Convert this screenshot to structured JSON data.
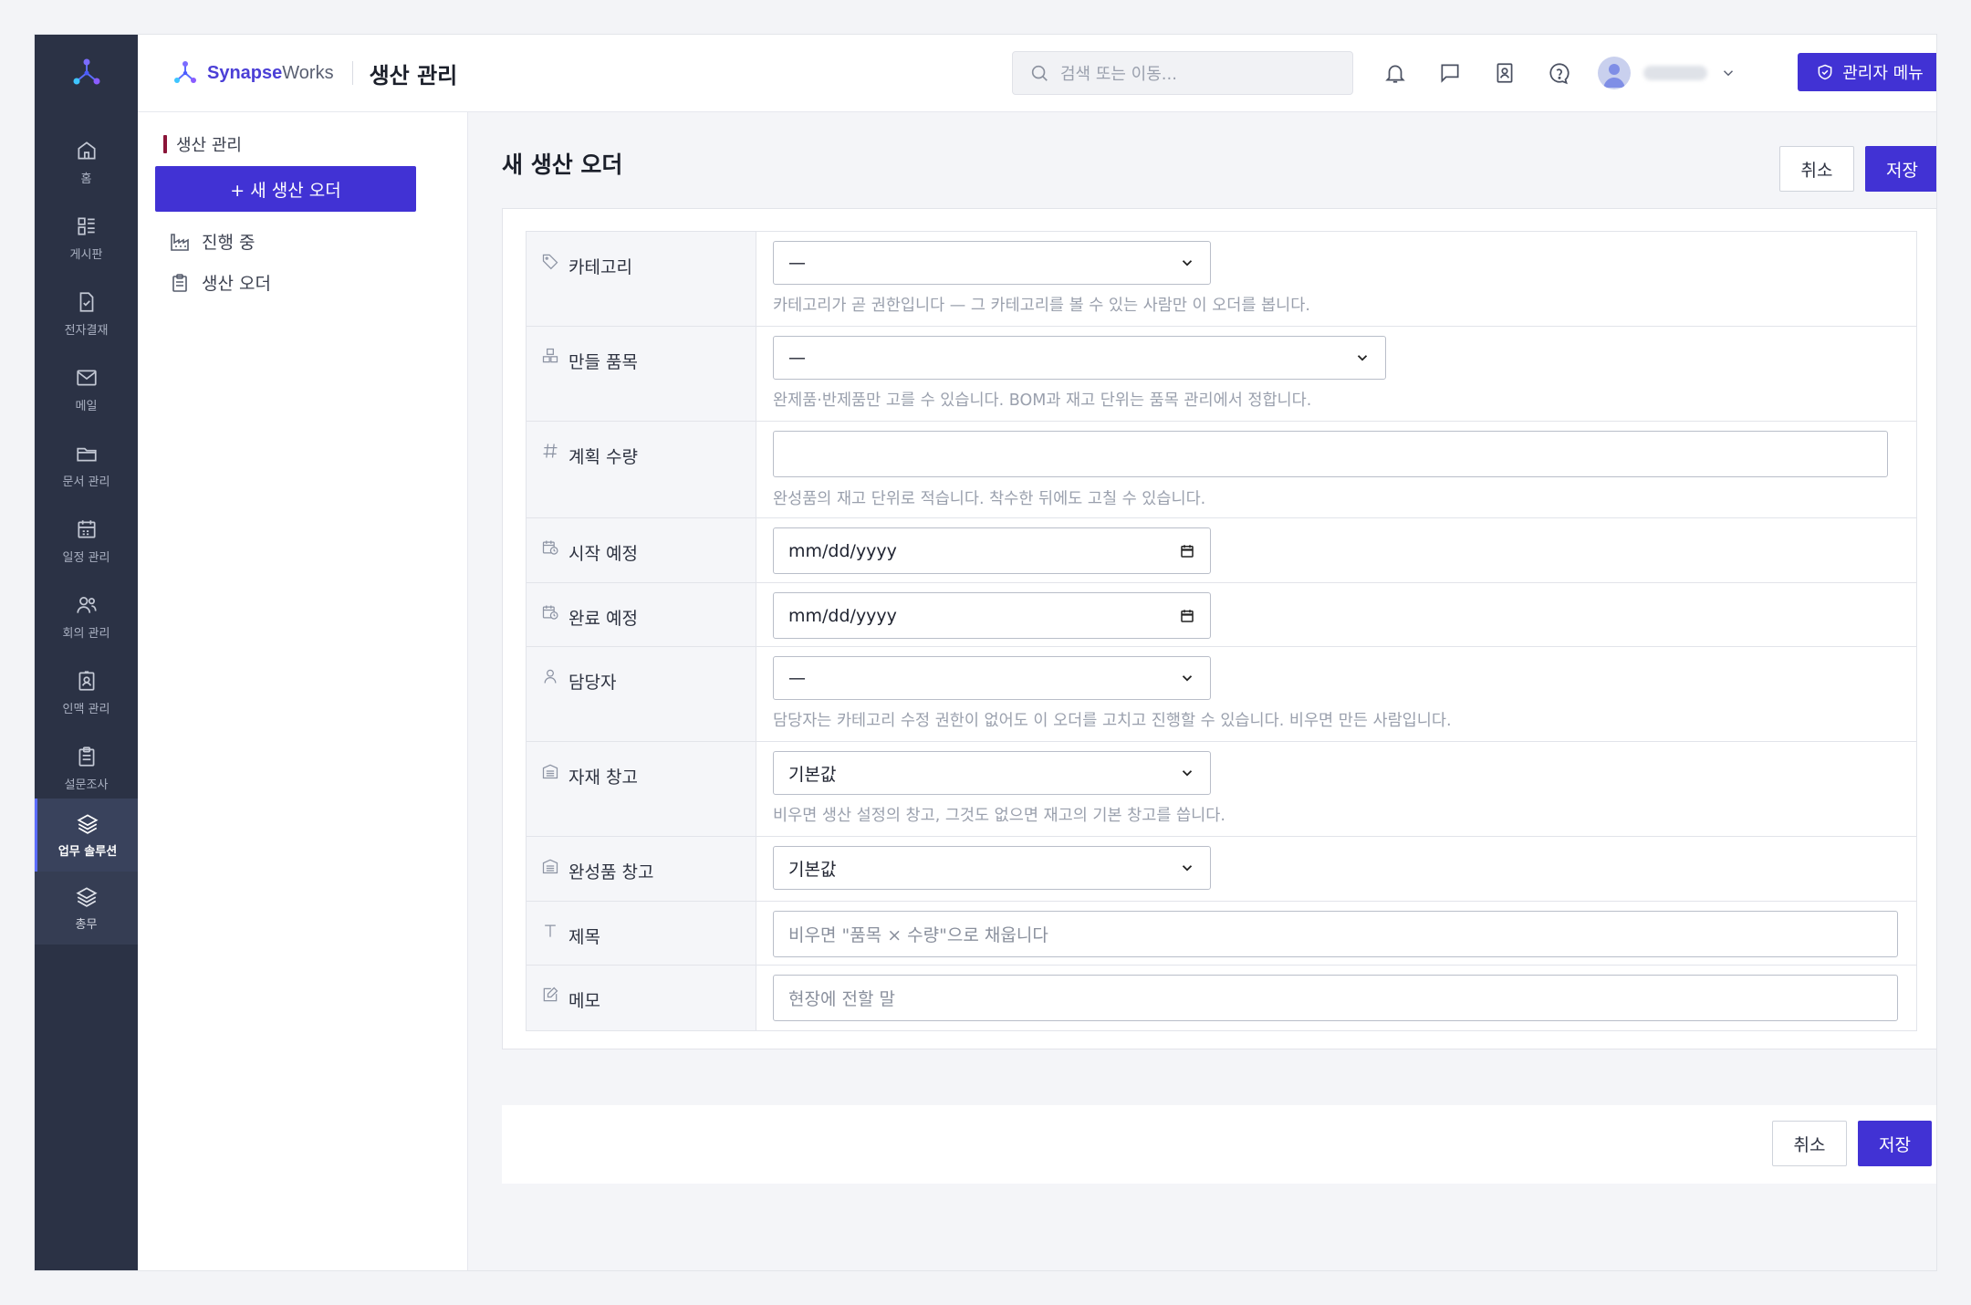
{
  "app": {
    "brand_bold": "Synapse",
    "brand_light": "Works",
    "section_title": "생산 관리",
    "search_placeholder": "검색 또는 이동...",
    "admin_menu": "관리자 메뉴",
    "accent_color": "#4132d4"
  },
  "rail": {
    "items": [
      {
        "label": "홈",
        "icon": "home-icon"
      },
      {
        "label": "게시판",
        "icon": "board-icon"
      },
      {
        "label": "전자결재",
        "icon": "approval-icon"
      },
      {
        "label": "메일",
        "icon": "mail-icon"
      },
      {
        "label": "문서 관리",
        "icon": "folder-icon"
      },
      {
        "label": "일정 관리",
        "icon": "calendar-icon"
      },
      {
        "label": "회의 관리",
        "icon": "users-icon"
      },
      {
        "label": "인맥 관리",
        "icon": "contact-icon"
      },
      {
        "label": "설문조사",
        "icon": "survey-icon"
      },
      {
        "label": "업무 솔루션",
        "icon": "layers-icon"
      },
      {
        "label": "총무",
        "icon": "layers-icon"
      }
    ]
  },
  "subnav": {
    "header": "생산 관리",
    "new_button": "+ 새 생산 오더",
    "items": [
      {
        "label": "진행 중",
        "icon": "factory-icon"
      },
      {
        "label": "생산 오더",
        "icon": "clipboard-icon"
      }
    ]
  },
  "page": {
    "title": "새 생산 오더",
    "cancel": "취소",
    "save": "저장"
  },
  "form": {
    "category": {
      "label": "카테고리",
      "value": "—",
      "help": "카테고리가 곧 권한입니다 — 그 카테고리를 볼 수 있는 사람만 이 오더를 봅니다."
    },
    "item": {
      "label": "만들 품목",
      "value": "—",
      "help": "완제품·반제품만 고를 수 있습니다. BOM과 재고 단위는 품목 관리에서 정합니다."
    },
    "quantity": {
      "label": "계획 수량",
      "value": "",
      "help": "완성품의 재고 단위로 적습니다. 착수한 뒤에도 고칠 수 있습니다."
    },
    "start": {
      "label": "시작 예정",
      "value": "mm/dd/yyyy"
    },
    "end": {
      "label": "완료 예정",
      "value": "mm/dd/yyyy"
    },
    "assignee": {
      "label": "담당자",
      "value": "—",
      "help": "담당자는 카테고리 수정 권한이 없어도 이 오더를 고치고 진행할 수 있습니다. 비우면 만든 사람입니다."
    },
    "material_wh": {
      "label": "자재 창고",
      "value": "기본값",
      "help": "비우면 생산 설정의 창고, 그것도 없으면 재고의 기본 창고를 씁니다."
    },
    "product_wh": {
      "label": "완성품 창고",
      "value": "기본값"
    },
    "title": {
      "label": "제목",
      "placeholder": "비우면 \"품목 × 수량\"으로 채웁니다"
    },
    "memo": {
      "label": "메모",
      "placeholder": "현장에 전할 말"
    }
  }
}
